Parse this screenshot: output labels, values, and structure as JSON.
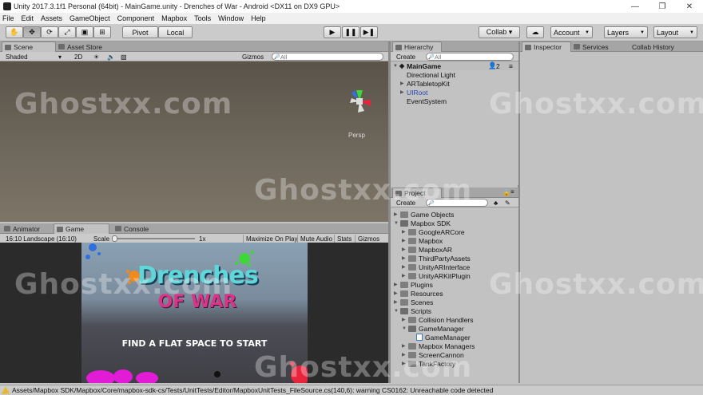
{
  "window": {
    "title": "Unity 2017.3.1f1 Personal (64bit) - MainGame.unity - Drenches of War - Android <DX11 on DX9 GPU>",
    "buttons": [
      "—",
      "❐",
      "✕"
    ]
  },
  "menu": [
    "File",
    "Edit",
    "Assets",
    "GameObject",
    "Component",
    "Mapbox",
    "Tools",
    "Window",
    "Help"
  ],
  "toolbar": {
    "pivot": "Pivot",
    "local": "Local",
    "play": "▶",
    "pause": "❚❚",
    "step": "▶❚",
    "collab": "Collab ▾",
    "account": "Account",
    "layers": "Layers",
    "layout": "Layout"
  },
  "scene": {
    "tabs": [
      "Scene",
      "Asset Store"
    ],
    "shading": "Shaded",
    "mode2d": "2D",
    "gizmos": "Gizmos",
    "search_placeholder": "All",
    "persp": "Persp"
  },
  "game": {
    "tabs": [
      "Animator",
      "Game",
      "Console"
    ],
    "aspect": "16:10 Landscape (16:10)",
    "scale_label": "Scale",
    "scale_value": "1x",
    "maximize": "Maximize On Play",
    "mute": "Mute Audio",
    "stats": "Stats",
    "gizmos": "Gizmos",
    "logo_line1": "Drenches",
    "logo_line2": "OF WAR",
    "prompt": "FIND A FLAT SPACE TO START"
  },
  "hierarchy": {
    "tab": "Hierarchy",
    "create": "Create",
    "search_placeholder": "All",
    "scene_name": "MainGame",
    "collab_count": "2",
    "items": [
      "Directional Light",
      "ARTabletopKit",
      "UIRoot",
      "EventSystem"
    ]
  },
  "project": {
    "tab": "Project",
    "create": "Create",
    "tree": [
      {
        "label": "Game Objects",
        "indent": 0,
        "type": "folder"
      },
      {
        "label": "Mapbox SDK",
        "indent": 0,
        "type": "folder-open"
      },
      {
        "label": "GoogleARCore",
        "indent": 1,
        "type": "folder"
      },
      {
        "label": "Mapbox",
        "indent": 1,
        "type": "folder"
      },
      {
        "label": "MapboxAR",
        "indent": 1,
        "type": "folder"
      },
      {
        "label": "ThirdPartyAssets",
        "indent": 1,
        "type": "folder"
      },
      {
        "label": "UnityARInterface",
        "indent": 1,
        "type": "folder"
      },
      {
        "label": "UnityARKitPlugin",
        "indent": 1,
        "type": "folder"
      },
      {
        "label": "Plugins",
        "indent": 0,
        "type": "folder"
      },
      {
        "label": "Resources",
        "indent": 0,
        "type": "folder"
      },
      {
        "label": "Scenes",
        "indent": 0,
        "type": "folder"
      },
      {
        "label": "Scripts",
        "indent": 0,
        "type": "folder-open"
      },
      {
        "label": "Collision Handlers",
        "indent": 1,
        "type": "folder"
      },
      {
        "label": "GameManager",
        "indent": 1,
        "type": "folder-open"
      },
      {
        "label": "GameManager",
        "indent": 2,
        "type": "script"
      },
      {
        "label": "Mapbox Managers",
        "indent": 1,
        "type": "folder"
      },
      {
        "label": "ScreenCannon",
        "indent": 1,
        "type": "folder"
      },
      {
        "label": "TankFactory",
        "indent": 1,
        "type": "folder"
      }
    ]
  },
  "inspector": {
    "tabs": [
      "Inspector",
      "Services",
      "Collab History"
    ]
  },
  "status": {
    "message": "Assets/Mapbox SDK/Mapbox/Core/mapbox-sdk-cs/Tests/UnitTests/Editor/MapboxUnitTests_FileSource.cs(140,6): warning CS0162: Unreachable code detected"
  },
  "watermark": "Ghostxx.com",
  "colors": {
    "editor_bg": "#c2c2c2",
    "selected_blue": "#3a5fcd",
    "logo_teal": "#5fd6d8",
    "logo_pink": "#d8348a",
    "splash_green": "#3fd63a",
    "splash_orange": "#f08a1e",
    "splash_magenta": "#e11bd6",
    "splash_red": "#e8243c",
    "splash_blue": "#2f6fe0"
  }
}
